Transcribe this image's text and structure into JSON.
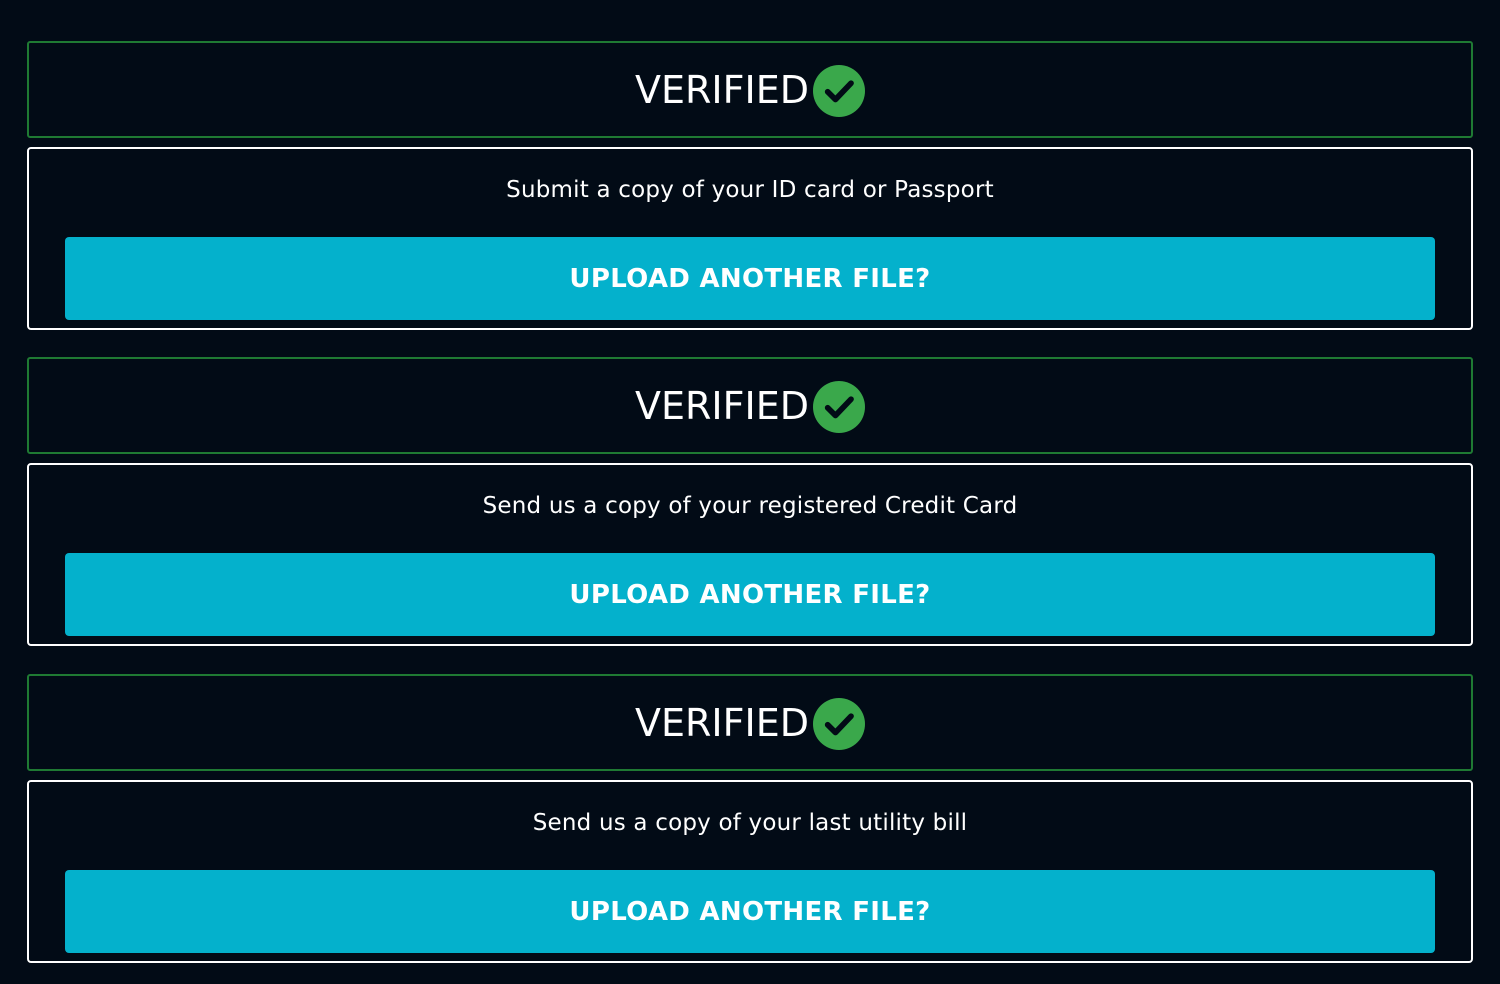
{
  "documents": [
    {
      "status": "VERIFIED",
      "status_icon": "check-circle-icon",
      "instruction": "Submit a copy of your ID card or Passport",
      "button_label": "UPLOAD ANOTHER FILE?"
    },
    {
      "status": "VERIFIED",
      "status_icon": "check-circle-icon",
      "instruction": "Send us a copy of your registered Credit Card",
      "button_label": "UPLOAD ANOTHER FILE?"
    },
    {
      "status": "VERIFIED",
      "status_icon": "check-circle-icon",
      "instruction": "Send us a copy of your last utility bill",
      "button_label": "UPLOAD ANOTHER FILE?"
    }
  ],
  "colors": {
    "background": "#020b16",
    "verified_border": "#1f7a33",
    "check_green": "#3aa84b",
    "button_cyan": "#04b1cc",
    "text": "#ffffff"
  }
}
